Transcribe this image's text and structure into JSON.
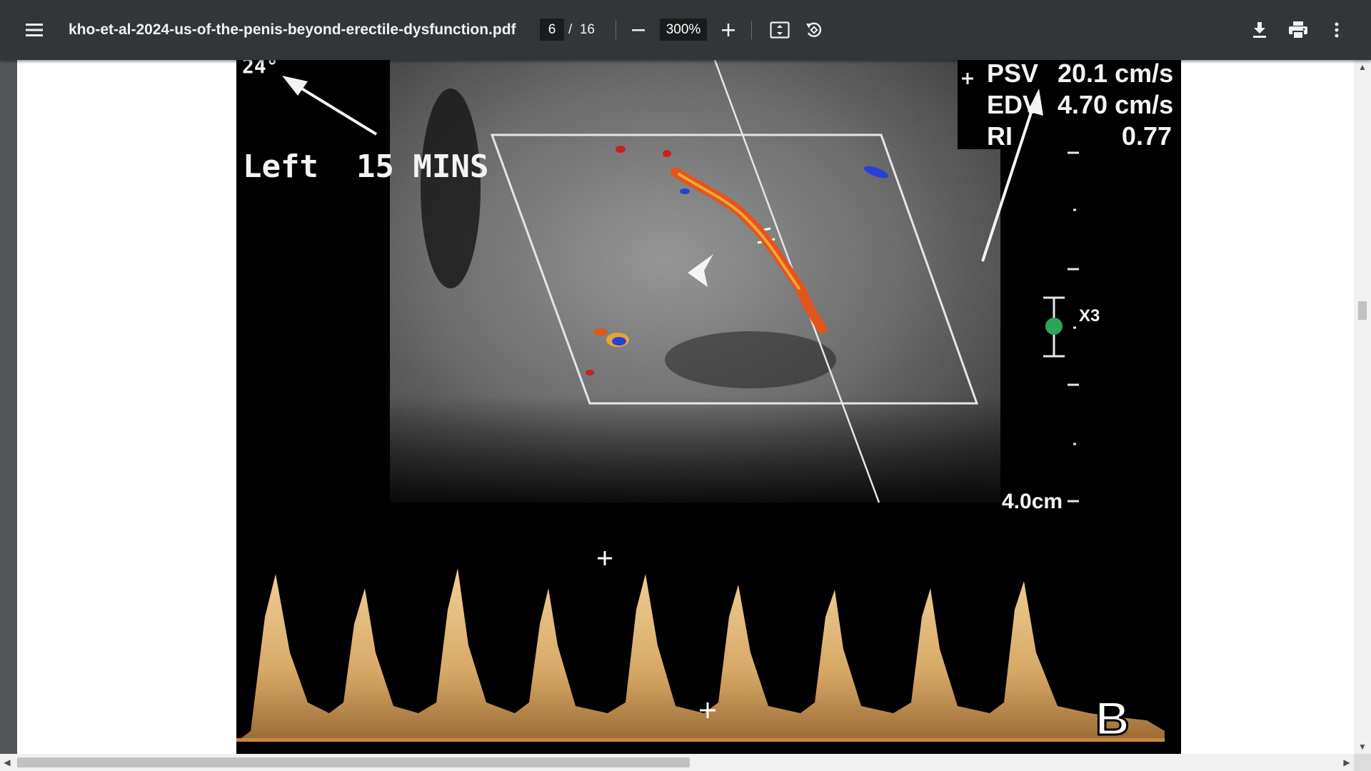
{
  "toolbar": {
    "menu_icon": "hamburger-menu-icon",
    "title": "kho-et-al-2024-us-of-the-penis-beyond-erectile-dysfunction.pdf",
    "page_current": "6",
    "page_total": "/  16",
    "zoom_out_icon": "minus-icon",
    "zoom_value": "300%",
    "zoom_in_icon": "plus-icon",
    "fit_icon": "fit-to-page-icon",
    "rotate_icon": "rotate-counterclockwise-icon",
    "download_icon": "download-icon",
    "print_icon": "print-icon",
    "more_icon": "more-vertical-icon"
  },
  "figure": {
    "angle_label": "24°",
    "side_label": "Left  15 MINS",
    "measurements": [
      {
        "name": "PSV",
        "value": "20.1 cm/s"
      },
      {
        "name": "EDV",
        "value": "4.70 cm/s"
      },
      {
        "name": "RI",
        "value": "0.77"
      }
    ],
    "depth_label": "4.0cm",
    "zoom_factor": "X3",
    "panel_letter": "B"
  },
  "scrollbars": {
    "up_icon": "scroll-up-arrow-icon",
    "down_icon": "scroll-down-arrow-icon",
    "left_icon": "scroll-left-arrow-icon",
    "right_icon": "scroll-right-arrow-icon"
  },
  "colors": {
    "toolbar_bg": "#323639",
    "viewer_bg": "#525659",
    "doppler_red": "#e2551d",
    "doppler_blue": "#2a3fd6",
    "spectral_tan": "#d8b176",
    "marker_green": "#2fa35a"
  }
}
